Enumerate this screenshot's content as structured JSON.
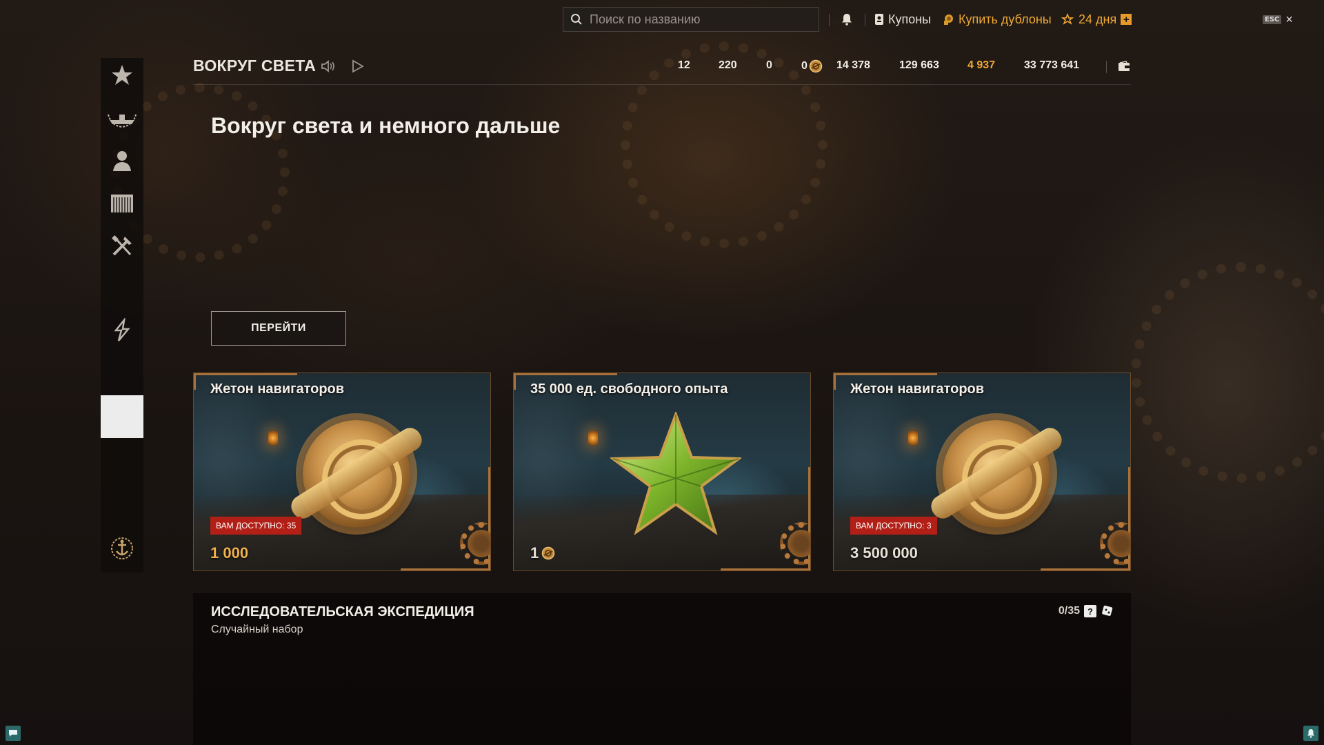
{
  "topbar": {
    "search_placeholder": "Поиск по названию",
    "notifications_icon": "bell-icon",
    "coupons_label": "Купоны",
    "buy_doubloons_label": "Купить дублоны",
    "premium_days_label": "24 дня",
    "esc_label": "ESC",
    "close_label": "×",
    "accent_color": "#f0a936"
  },
  "event": {
    "title": "ВОКРУГ СВЕТА",
    "hero_title": "Вокруг света и немного дальше",
    "go_button_label": "ПЕРЕЙТИ"
  },
  "stats": [
    "12",
    "220",
    "0",
    "0",
    "14 378",
    "129 663",
    "4 937",
    "33 773 641"
  ],
  "sidebar": {
    "items": [
      "star-icon",
      "ship-wreath-icon",
      "captain-icon",
      "containers-icon",
      "tools-icon",
      "collections-icon",
      "selected-tile",
      "anchor-clan-icon"
    ]
  },
  "cards": [
    {
      "title": "Жетон навигаторов",
      "badge": "ВАМ ДОСТУПНО: 35",
      "price": "1 000",
      "price_currency": "",
      "image": "navigator-token-medal"
    },
    {
      "title": "35 000 ед. свободного опыта",
      "badge": "",
      "price": "1",
      "price_currency": "navigator-token-icon",
      "image": "free-xp-star"
    },
    {
      "title": "Жетон навигаторов",
      "badge": "ВАМ ДОСТУПНО: 3",
      "price": "3 500 000",
      "price_currency": "",
      "image": "navigator-token-medal"
    }
  ],
  "expedition": {
    "title": "ИССЛЕДОВАТЕЛЬСКАЯ ЭКСПЕДИЦИЯ",
    "subtitle": "Случайный набор",
    "progress": "0/35",
    "help_label": "?"
  }
}
